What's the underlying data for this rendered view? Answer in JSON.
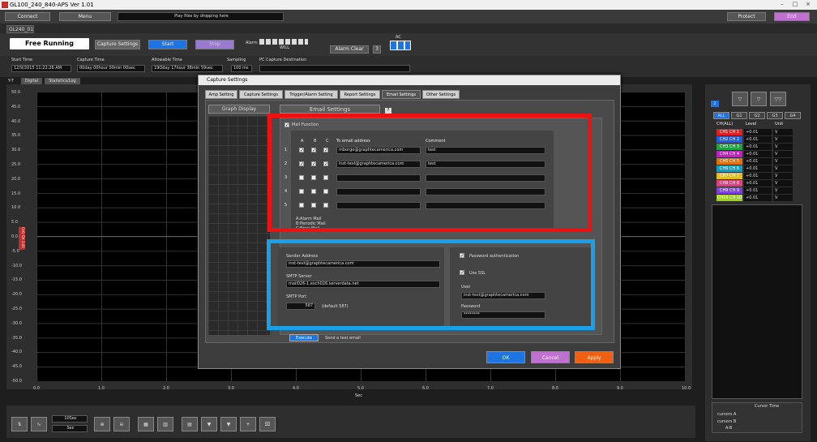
{
  "window": {
    "title": "GL100_240_840-APS Ver 1.01"
  },
  "toolbar": {
    "connect": "Connect",
    "menu": "Menu",
    "drop_hint": "Play files by dropping here",
    "protect": "Protect",
    "end": "End"
  },
  "device_tab": "GL240_01",
  "status": {
    "mode": "Free Running",
    "capture_settings": "Capture Settings",
    "start": "Start",
    "stop": "Stop",
    "alarm_label": "Alarm",
    "alarm_sub": "WILL",
    "alarm_clear": "Alarm Clear",
    "alarm_clear_count": "3",
    "ac_label": "AC"
  },
  "times": {
    "start_time_label": "Start Time",
    "start_time": "12/9/2015 11:22:26 AM",
    "capture_time_label": "Capture Time",
    "capture_time": "00day 00hour 00min 00sec",
    "allowable_label": "Allowable Time",
    "allowable": "19Oday 17hour 38min 59sec",
    "sampling_label": "Sampling",
    "sampling": "100 ms",
    "pc_dest_label": "PC Capture Destination"
  },
  "view_tabs": [
    "Y-T",
    "Digital",
    "Statistics/Log"
  ],
  "graph": {
    "y_ticks": [
      "50.0",
      "45.0",
      "40.0",
      "35.0",
      "30.0",
      "25.0",
      "20.0",
      "15.0",
      "10.0",
      "5.0",
      "0.0",
      "-5.0",
      "-10.0",
      "-15.0",
      "-20.0",
      "-25.0",
      "-30.0",
      "-35.0",
      "-40.0",
      "-45.0",
      "-50.0"
    ],
    "x_ticks": [
      "0.0",
      "1.0",
      "2.0",
      "3.0",
      "4.0",
      "5.0",
      "6.0",
      "7.0",
      "8.0",
      "9.0",
      "10.0"
    ],
    "x_label": "Sec",
    "channel_tag": "CH1 CH 2.03",
    "bottom_time": "10Sec",
    "bottom_unit": "Sec"
  },
  "right_panel": {
    "groups": [
      "ALL",
      "G1",
      "G2",
      "G3",
      "G4"
    ],
    "badge": "2",
    "col_channel": "CH(ALL)",
    "col_level": "Level",
    "col_unit": "Unit",
    "channels": [
      {
        "name": "CH1  CH 1",
        "level": "+0.01",
        "unit": "V",
        "color": "#e02020"
      },
      {
        "name": "CH2  CH 2",
        "level": "+0.01",
        "unit": "V",
        "color": "#2060e0"
      },
      {
        "name": "CH3  CH 3",
        "level": "+0.01",
        "unit": "V",
        "color": "#20a040"
      },
      {
        "name": "CH4  CH 4",
        "level": "+0.01",
        "unit": "V",
        "color": "#c020c0"
      },
      {
        "name": "CH5  CH 5",
        "level": "+0.01",
        "unit": "V",
        "color": "#e07010"
      },
      {
        "name": "CH6  CH 6",
        "level": "+0.01",
        "unit": "V",
        "color": "#10a0c0"
      },
      {
        "name": "CH7  CH 7",
        "level": "+0.01",
        "unit": "V",
        "color": "#e0c020"
      },
      {
        "name": "CH8  CH 8",
        "level": "+0.01",
        "unit": "V",
        "color": "#e04080"
      },
      {
        "name": "CH9  CH 9",
        "level": "+0.01",
        "unit": "V",
        "color": "#8040e0"
      },
      {
        "name": "CH10 CH 10",
        "level": "+0.01",
        "unit": "V",
        "color": "#a0d020"
      }
    ],
    "cursor_time": "Cursor Time",
    "cursors": [
      "cursors A",
      "cursors B",
      "A-B"
    ]
  },
  "dialog": {
    "title": "Capture Settings",
    "tabs": [
      "Amp Setting",
      "Capture Settings",
      "Trigger/Alarm Setting",
      "Report Settings",
      "Email Settings",
      "Other Settings"
    ],
    "left_panel": "Graph Display",
    "section_title": "Email Settings",
    "mail_function": "Mail Function",
    "col_a": "A",
    "col_b": "B",
    "col_c": "C",
    "col_to": "To email address",
    "col_comment": "Comment",
    "rows": [
      {
        "num": "1",
        "a": true,
        "b": true,
        "c": true,
        "to": "mborge@graphtecamerica.com",
        "comment": "test"
      },
      {
        "num": "2",
        "a": true,
        "b": true,
        "c": true,
        "to": "inst-test@graphtecamerica.com",
        "comment": "test"
      },
      {
        "num": "3",
        "a": false,
        "b": false,
        "c": false,
        "to": "",
        "comment": ""
      },
      {
        "num": "4",
        "a": false,
        "b": false,
        "c": false,
        "to": "",
        "comment": ""
      },
      {
        "num": "5",
        "a": false,
        "b": false,
        "c": false,
        "to": "",
        "comment": ""
      }
    ],
    "legend": [
      "A:Alarm Mail",
      "B:Periodic Mail",
      "C:Error Mail"
    ],
    "sender_label": "Sender Address",
    "sender": "inst-test@graphtecamerica.com",
    "smtp_label": "SMTP Server",
    "smtp": "mail026-1.exch026.serverdata.net",
    "port_label": "SMTP Port",
    "port": "587",
    "port_default": "(default 587)",
    "pw_auth": "Password authentication",
    "use_ssl": "Use SSL",
    "user_label": "User",
    "user": "inst-test@graphtecamerica.com",
    "password_label": "Password",
    "password": "********",
    "execute": "Execute",
    "send_test": "Send a test email",
    "ok": "OK",
    "cancel": "Cancel",
    "apply": "Apply"
  },
  "colors": {
    "red_highlight": "#ee1111",
    "blue_highlight": "#1aa0e8",
    "ok": "#1e74e0",
    "cancel": "#c070d0",
    "apply": "#f06010"
  }
}
